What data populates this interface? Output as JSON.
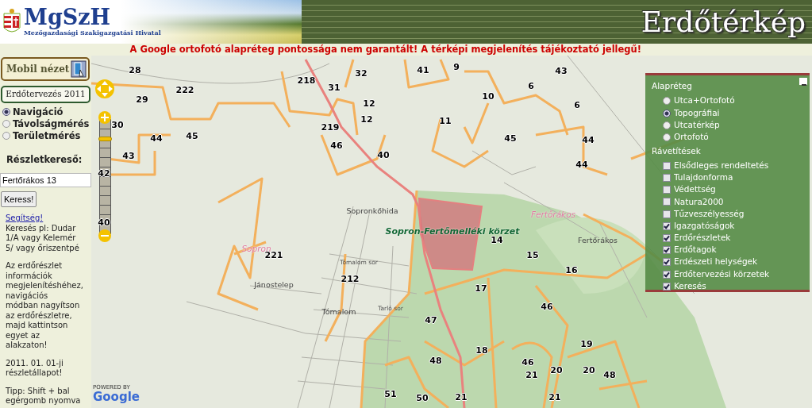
{
  "header": {
    "logo_text": "MgSzH",
    "logo_subtitle": "Mezőgazdasági Szakigazgatási Hivatal",
    "title": "Erdőtérkép"
  },
  "notice": "A Google ortofotó alapréteg pontossága nem garantált! A térképi megjelenítés tájékoztató jellegű!",
  "sidebar": {
    "mobile_button": "Mobil nézet",
    "plan_label": "Erdőtervezés 2011",
    "modes": [
      {
        "label": "Navigáció",
        "selected": true
      },
      {
        "label": "Távolságmérés",
        "selected": false
      },
      {
        "label": "Területmérés",
        "selected": false
      }
    ],
    "search": {
      "label": "Részletkereső:",
      "value": "Fertőrákos 13",
      "button": "Keress!"
    },
    "help_link": "Segítség!",
    "paragraphs": [
      "Keresés pl: Dudar 1/A vagy Kelemér 5/ vagy őriszentpé",
      "Az erdőrészlet információk megjelenítéshéhez, navigációs módban nagyítson az erdőrészletre, majd kattintson egyet az alakzaton!",
      "2011. 01. 01-ji részletállapot!",
      "Tipp: Shift + bal egérgomb nyomva"
    ]
  },
  "zoom": {
    "level": 0.85
  },
  "layers": {
    "base_title": "Alapréteg",
    "base": [
      {
        "label": "Utca+Ortofotó",
        "selected": false
      },
      {
        "label": "Topográfiai",
        "selected": true
      },
      {
        "label": "Utcatérkép",
        "selected": false
      },
      {
        "label": "Ortofotó",
        "selected": false
      }
    ],
    "overlay_title": "Rávetítések",
    "overlays": [
      {
        "label": "Elsődleges rendeltetés",
        "checked": false
      },
      {
        "label": "Tulajdonforma",
        "checked": false
      },
      {
        "label": "Védettség",
        "checked": false
      },
      {
        "label": "Natura2000",
        "checked": false
      },
      {
        "label": "Tűzveszélyesség",
        "checked": false
      },
      {
        "label": "Igazgatóságok",
        "checked": true
      },
      {
        "label": "Erdőrészletek",
        "checked": true
      },
      {
        "label": "Erdőtagok",
        "checked": true
      },
      {
        "label": "Erdészeti helységek",
        "checked": true
      },
      {
        "label": "Erdőtervezési körzetek",
        "checked": true
      },
      {
        "label": "Keresés",
        "checked": true
      }
    ]
  },
  "map": {
    "attribution": "POWERED BY",
    "provider": "Google",
    "labels": [
      {
        "text": "28",
        "kind": "number"
      },
      {
        "text": "222",
        "kind": "number"
      },
      {
        "text": "29",
        "kind": "number"
      },
      {
        "text": "30",
        "kind": "number"
      },
      {
        "text": "44",
        "kind": "number"
      },
      {
        "text": "45",
        "kind": "number"
      },
      {
        "text": "43",
        "kind": "number"
      },
      {
        "text": "42",
        "kind": "number"
      },
      {
        "text": "40",
        "kind": "number"
      },
      {
        "text": "218",
        "kind": "number"
      },
      {
        "text": "31",
        "kind": "number"
      },
      {
        "text": "32",
        "kind": "number"
      },
      {
        "text": "41",
        "kind": "number"
      },
      {
        "text": "9",
        "kind": "number"
      },
      {
        "text": "6",
        "kind": "number"
      },
      {
        "text": "43",
        "kind": "number"
      },
      {
        "text": "10",
        "kind": "number"
      },
      {
        "text": "12",
        "kind": "number"
      },
      {
        "text": "12",
        "kind": "number"
      },
      {
        "text": "219",
        "kind": "number"
      },
      {
        "text": "11",
        "kind": "number"
      },
      {
        "text": "6",
        "kind": "number"
      },
      {
        "text": "46",
        "kind": "number"
      },
      {
        "text": "45",
        "kind": "number"
      },
      {
        "text": "44",
        "kind": "number"
      },
      {
        "text": "40",
        "kind": "number"
      },
      {
        "text": "44",
        "kind": "number"
      },
      {
        "text": "14",
        "kind": "number"
      },
      {
        "text": "15",
        "kind": "number"
      },
      {
        "text": "16",
        "kind": "number"
      },
      {
        "text": "17",
        "kind": "number"
      },
      {
        "text": "212",
        "kind": "number"
      },
      {
        "text": "221",
        "kind": "number"
      },
      {
        "text": "46",
        "kind": "number"
      },
      {
        "text": "47",
        "kind": "number"
      },
      {
        "text": "19",
        "kind": "number"
      },
      {
        "text": "18",
        "kind": "number"
      },
      {
        "text": "48",
        "kind": "number"
      },
      {
        "text": "46",
        "kind": "number"
      },
      {
        "text": "21",
        "kind": "number"
      },
      {
        "text": "20",
        "kind": "number"
      },
      {
        "text": "20",
        "kind": "number"
      },
      {
        "text": "48",
        "kind": "number"
      },
      {
        "text": "51",
        "kind": "number"
      },
      {
        "text": "50",
        "kind": "number"
      },
      {
        "text": "21",
        "kind": "number"
      },
      {
        "text": "21",
        "kind": "number"
      },
      {
        "text": "Sopronkőhida",
        "kind": "place"
      },
      {
        "text": "Jánostelep",
        "kind": "place"
      },
      {
        "text": "Tómalom",
        "kind": "place"
      },
      {
        "text": "Fertőrákos",
        "kind": "place"
      },
      {
        "text": "Sopron",
        "kind": "town"
      },
      {
        "text": "Fertőrákos",
        "kind": "town"
      },
      {
        "text": "Sopron-Fertőmelléki körzet",
        "kind": "district"
      },
      {
        "text": "Tómalom sor",
        "kind": "street"
      },
      {
        "text": "Tarló sor",
        "kind": "street"
      }
    ]
  }
}
